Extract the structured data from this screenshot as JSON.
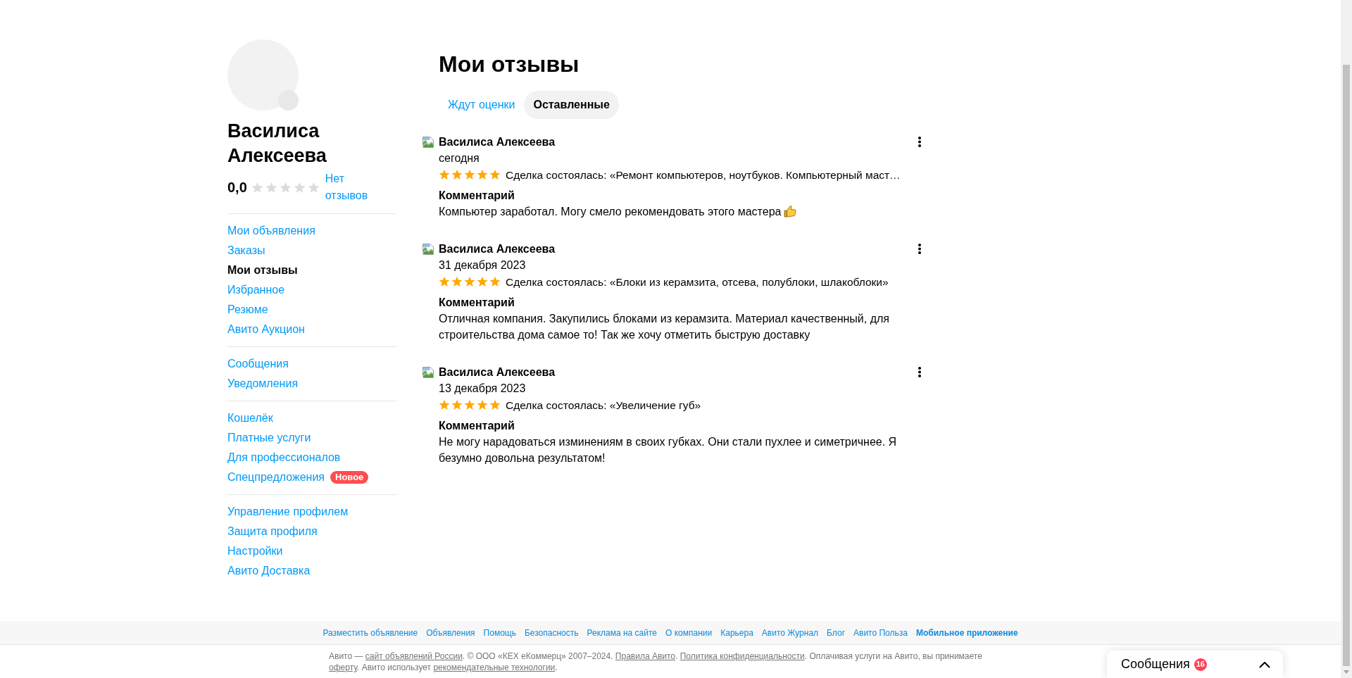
{
  "profile": {
    "name": "Василиса Алексеева",
    "rating": {
      "value": "0,0",
      "stars": 0,
      "reviews_link": "Нет отзывов"
    }
  },
  "sidebar": {
    "groups": [
      {
        "items": [
          {
            "label": "Мои объявления",
            "selected": false
          },
          {
            "label": "Заказы",
            "selected": false
          },
          {
            "label": "Мои отзывы",
            "selected": true
          },
          {
            "label": "Избранное",
            "selected": false
          },
          {
            "label": "Резюме",
            "selected": false
          },
          {
            "label": "Авито Аукцион",
            "selected": false
          }
        ]
      },
      {
        "items": [
          {
            "label": "Сообщения",
            "selected": false
          },
          {
            "label": "Уведомления",
            "selected": false
          }
        ]
      },
      {
        "items": [
          {
            "label": "Кошелёк",
            "selected": false
          },
          {
            "label": "Платные услуги",
            "selected": false
          },
          {
            "label": "Для профессионалов",
            "selected": false
          },
          {
            "label": "Спецпредложения",
            "selected": false,
            "badge": "Новое"
          }
        ]
      },
      {
        "items": [
          {
            "label": "Управление профилем",
            "selected": false
          },
          {
            "label": "Защита профиля",
            "selected": false
          },
          {
            "label": "Настройки",
            "selected": false
          },
          {
            "label": "Авито Доставка",
            "selected": false
          }
        ]
      }
    ]
  },
  "page_title": "Мои отзывы",
  "tabs": [
    {
      "label": "Ждут оценки",
      "selected": false
    },
    {
      "label": "Оставленные",
      "selected": true
    }
  ],
  "reviews": [
    {
      "author": "Василиса Алексеева",
      "date": "сегодня",
      "stars": 5,
      "deal": "Сделка состоялась: «Ремонт компьютеров, ноутбуков. Компьютерный маст…",
      "comment_label": "Комментарий",
      "comment": "Компьютер заработал. Могу смело рекомендовать этого мастера",
      "emoji": true
    },
    {
      "author": "Василиса Алексеева",
      "date": "31 декабря 2023",
      "stars": 5,
      "deal": "Сделка состоялась: «Блоки из керамзита, отсева, полублоки, шлакоблоки»",
      "comment_label": "Комментарий",
      "comment": "Отличная компания. Закупились блоками из керамзита. Материал качественный, для строительства дома самое то! Так же хочу отметить быструю доставку"
    },
    {
      "author": "Василиса Алексеева",
      "date": "13 декабря 2023",
      "stars": 5,
      "deal": "Сделка состоялась: «Увеличение губ»",
      "comment_label": "Комментарий",
      "comment": "Не могу нарадоваться изминениям в своих губках. Они стали пухлее и симетричнее. Я безумно довольна результатом!"
    }
  ],
  "footer": {
    "links": [
      {
        "label": "Разместить объявление",
        "emphasized": false
      },
      {
        "label": "Объявления",
        "emphasized": false
      },
      {
        "label": "Помощь",
        "emphasized": false
      },
      {
        "label": "Безопасность",
        "emphasized": false
      },
      {
        "label": "Реклама на сайте",
        "emphasized": false
      },
      {
        "label": "О компании",
        "emphasized": false
      },
      {
        "label": "Карьера",
        "emphasized": false
      },
      {
        "label": "Авито Журнал",
        "emphasized": false
      },
      {
        "label": "Блог",
        "emphasized": false
      },
      {
        "label": "Авито Польза",
        "emphasized": false
      },
      {
        "label": "Мобильное приложение",
        "emphasized": true
      }
    ],
    "legal": [
      {
        "kind": "text",
        "text": "Авито — "
      },
      {
        "kind": "link",
        "text": "сайт объявлений России"
      },
      {
        "kind": "text",
        "text": ". © ООО «КЕХ еКоммерц» 2007–2024. "
      },
      {
        "kind": "link",
        "text": "Правила Авито"
      },
      {
        "kind": "text",
        "text": ". "
      },
      {
        "kind": "link",
        "text": "Политика конфиденциальности"
      },
      {
        "kind": "text",
        "text": ". Оплачивая услуги на Авито, вы принимаете "
      },
      {
        "kind": "link",
        "text": "оферту"
      },
      {
        "kind": "text",
        "text": ". Авито использует "
      },
      {
        "kind": "link",
        "text": "рекомендательные технологии"
      },
      {
        "kind": "text",
        "text": "."
      }
    ]
  },
  "messages_widget": {
    "label": "Сообщения",
    "count": "16",
    "expanded": false
  }
}
